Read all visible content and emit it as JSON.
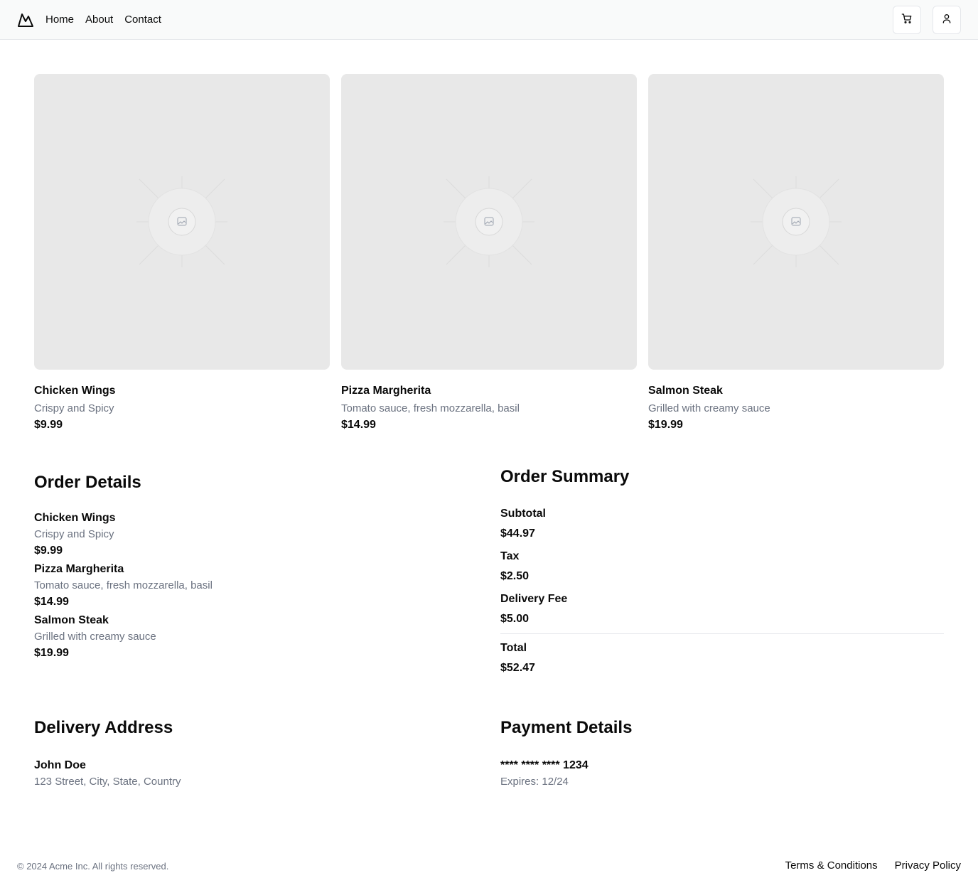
{
  "header": {
    "logo_icon": "mountain-logo-icon",
    "nav": [
      "Home",
      "About",
      "Contact"
    ],
    "cart_icon": "shopping-cart-icon",
    "user_icon": "user-icon"
  },
  "products": [
    {
      "name": "Chicken Wings",
      "description": "Crispy and Spicy",
      "price": "$9.99",
      "image": "placeholder-image-icon"
    },
    {
      "name": "Pizza Margherita",
      "description": "Tomato sauce, fresh mozzarella, basil",
      "price": "$14.99",
      "image": "placeholder-image-icon"
    },
    {
      "name": "Salmon Steak",
      "description": "Grilled with creamy sauce",
      "price": "$19.99",
      "image": "placeholder-image-icon"
    }
  ],
  "order_details": {
    "title": "Order Details",
    "items": [
      {
        "name": "Chicken Wings",
        "description": "Crispy and Spicy",
        "price": "$9.99"
      },
      {
        "name": "Pizza Margherita",
        "description": "Tomato sauce, fresh mozzarella, basil",
        "price": "$14.99"
      },
      {
        "name": "Salmon Steak",
        "description": "Grilled with creamy sauce",
        "price": "$19.99"
      }
    ]
  },
  "order_summary": {
    "title": "Order Summary",
    "subtotal_label": "Subtotal",
    "subtotal_value": "$44.97",
    "tax_label": "Tax",
    "tax_value": "$2.50",
    "delivery_label": "Delivery Fee",
    "delivery_value": "$5.00",
    "total_label": "Total",
    "total_value": "$52.47"
  },
  "delivery_address": {
    "title": "Delivery Address",
    "name": "John Doe",
    "address": "123 Street, City, State, Country"
  },
  "payment_details": {
    "title": "Payment Details",
    "card_number": "**** **** **** 1234",
    "expires": "Expires: 12/24"
  },
  "footer": {
    "copyright": "© 2024 Acme Inc. All rights reserved.",
    "links": [
      "Terms & Conditions",
      "Privacy Policy"
    ]
  }
}
